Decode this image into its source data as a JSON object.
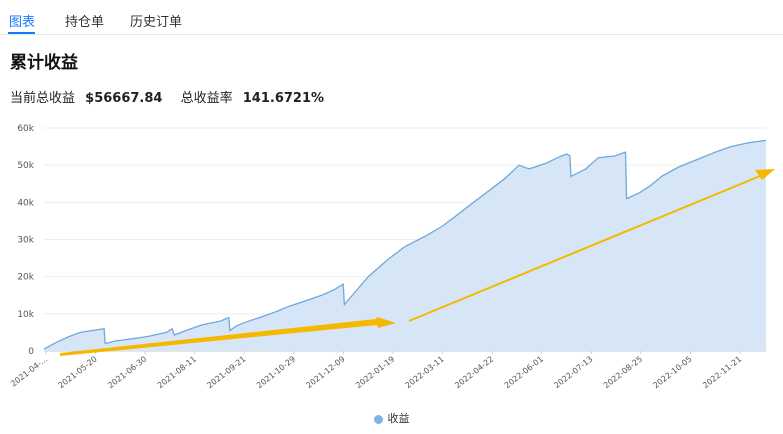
{
  "tabs": [
    {
      "label": "图表",
      "active": true
    },
    {
      "label": "持仓单",
      "active": false
    },
    {
      "label": "历史订单",
      "active": false
    }
  ],
  "title": "累计收益",
  "summary": {
    "current_label": "当前总收益",
    "current_value": "$56667.84",
    "rate_label": "总收益率",
    "rate_value": "141.6721%"
  },
  "colors": {
    "accent": "#1677ff",
    "line": "#6fa8dc",
    "area": "#d6e6f7",
    "arrow": "#f5b800"
  },
  "chart_data": {
    "type": "area",
    "ylim": [
      0,
      60000
    ],
    "y_ticks": [
      "0",
      "10k",
      "20k",
      "30k",
      "40k",
      "50k",
      "60k"
    ],
    "x_tick_labels": [
      "2021-04-...",
      "2021-05-20",
      "2021-06-30",
      "2021-08-11",
      "2021-09-21",
      "2021-10-29",
      "2021-12-09",
      "2022-01-19",
      "2022-03-11",
      "2022-04-22",
      "2022-06-01",
      "2022-07-13",
      "2022-08-25",
      "2022-10-05",
      "2022-11-21"
    ],
    "grid": true,
    "legend": "bottom",
    "series": [
      {
        "name": "收益",
        "x": [
          "2021-04-08",
          "2021-04-20",
          "2021-05-01",
          "2021-05-10",
          "2021-05-20",
          "2021-05-31",
          "2021-06-01",
          "2021-06-10",
          "2021-06-20",
          "2021-06-30",
          "2021-07-10",
          "2021-07-25",
          "2021-07-30",
          "2021-08-01",
          "2021-08-11",
          "2021-08-25",
          "2021-09-10",
          "2021-09-18",
          "2021-09-19",
          "2021-09-25",
          "2021-10-05",
          "2021-10-15",
          "2021-10-29",
          "2021-11-10",
          "2021-11-25",
          "2021-12-09",
          "2021-12-20",
          "2021-12-28",
          "2021-12-29",
          "2022-01-05",
          "2022-01-19",
          "2022-02-05",
          "2022-02-20",
          "2022-03-11",
          "2022-03-25",
          "2022-04-05",
          "2022-04-22",
          "2022-05-05",
          "2022-05-20",
          "2022-06-01",
          "2022-06-10",
          "2022-06-25",
          "2022-07-05",
          "2022-07-13",
          "2022-07-16",
          "2022-07-17",
          "2022-07-30",
          "2022-08-10",
          "2022-08-25",
          "2022-09-03",
          "2022-09-04",
          "2022-09-15",
          "2022-09-25",
          "2022-10-05",
          "2022-10-20",
          "2022-11-05",
          "2022-11-21",
          "2022-12-05",
          "2022-12-20",
          "2023-01-05"
        ],
        "values": [
          500,
          2500,
          4000,
          5000,
          5500,
          6000,
          2000,
          2700,
          3100,
          3500,
          4000,
          5000,
          6000,
          4300,
          5500,
          7000,
          8000,
          9000,
          5500,
          6800,
          8000,
          9000,
          10500,
          12000,
          13500,
          15000,
          16500,
          18000,
          12500,
          15000,
          20000,
          24500,
          28000,
          31000,
          33500,
          36000,
          40000,
          43000,
          46500,
          50000,
          49000,
          50500,
          52000,
          53000,
          52500,
          47000,
          49000,
          52000,
          52500,
          53500,
          41000,
          42500,
          44500,
          47000,
          49500,
          51500,
          53500,
          55000,
          56000,
          56667.84
        ]
      }
    ]
  }
}
